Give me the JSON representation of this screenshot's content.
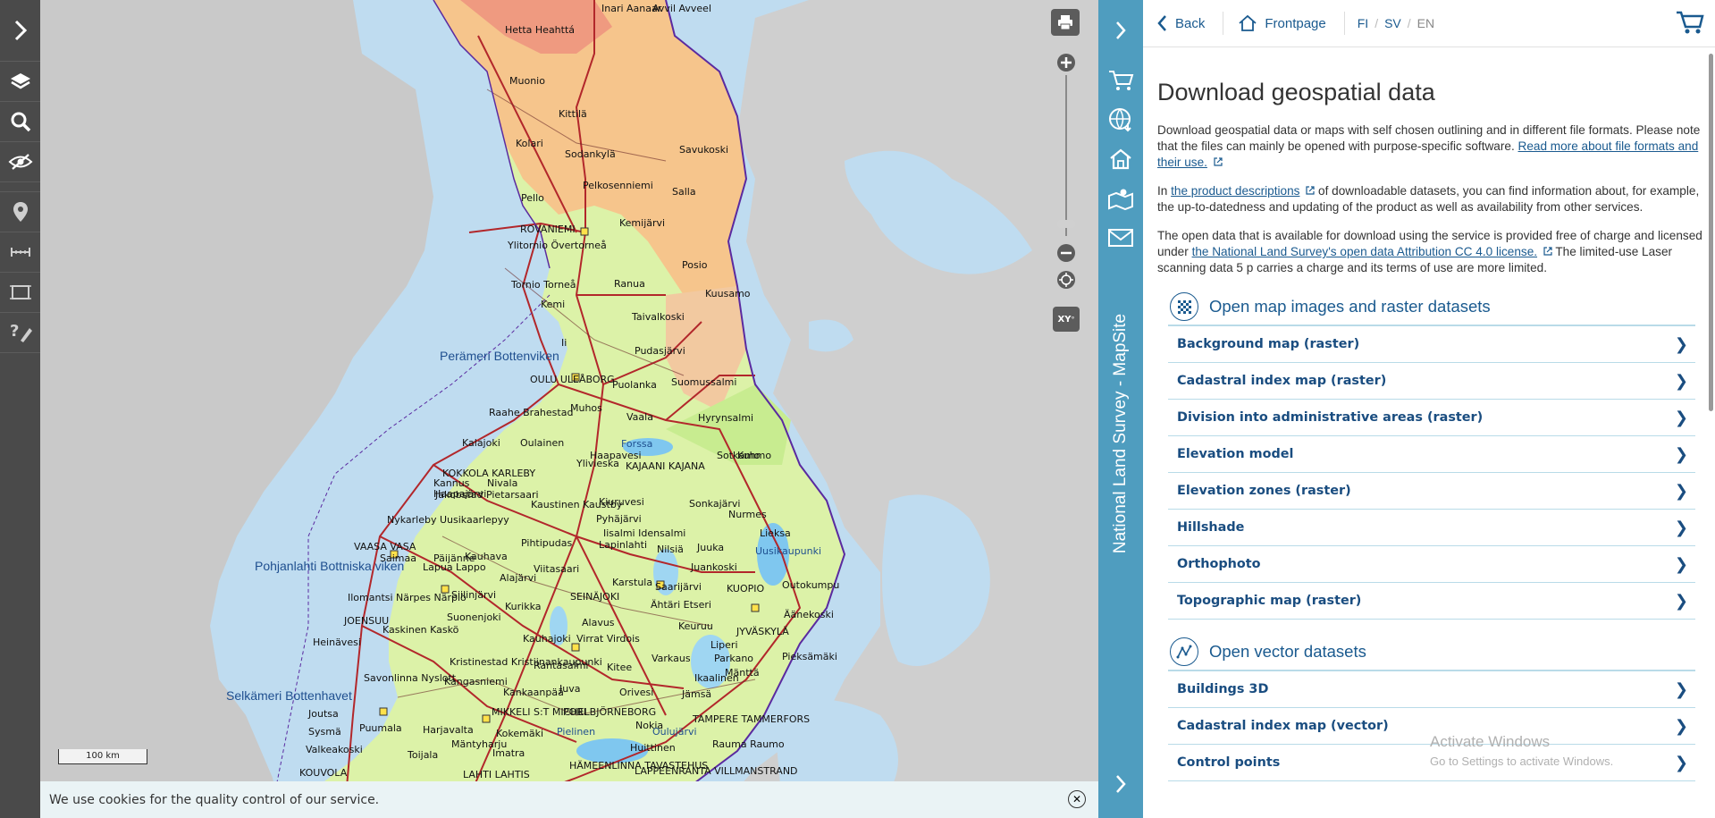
{
  "panel": {
    "back": "Back",
    "frontpage": "Frontpage",
    "lang_fi": "FI",
    "lang_sv": "SV",
    "lang_en": "EN",
    "sep": "/",
    "title": "Download geospatial data",
    "p1_text": "Download geospatial data or maps with self chosen outlining and in different file formats. Please note that the files can mainly be opened with purpose-specific software.",
    "p1_link": "Read more about file formats and their use.",
    "p2_pre": "In",
    "p2_link": "the product descriptions",
    "p2_post": "of downloadable datasets, you can find information about, for example, the up-to-datedness and updating of the product as well as availability from other services.",
    "p3_pre": "The open data that is available for download using the service is provided free of charge and licensed under",
    "p3_link": "the National Land Survey's open data Attribution CC 4.0 license.",
    "p3_post": "The limited-use Laser scanning data 5 p carries a charge and its terms of use are more limited.",
    "sections": [
      {
        "title": "Open map images and raster datasets",
        "items": [
          "Background map (raster)",
          "Cadastral index map (raster)",
          "Division into administrative areas (raster)",
          "Elevation model",
          "Elevation zones (raster)",
          "Hillshade",
          "Orthophoto",
          "Topographic map (raster)"
        ]
      },
      {
        "title": "Open vector datasets",
        "items": [
          "Buildings 3D",
          "Cadastral index map (vector)",
          "Control points"
        ]
      }
    ]
  },
  "rail": {
    "title": "National Land Survey - MapSite"
  },
  "map": {
    "scale": "100 km",
    "xy_label": "XY",
    "sea_labels": [
      "Perämeri Bottenviken",
      "Pohjanlahti Bottniska viken",
      "Selkämeri Bottenhavet"
    ],
    "places": [
      "Hetta Heahttá",
      "Inari Aanaar",
      "Avvil Avveel",
      "Muonio",
      "Kittilä",
      "Kolari",
      "Sodankylä",
      "Savukoski",
      "Pelkosenniemi",
      "Pello",
      "Salla",
      "Kemijärvi",
      "ROVANIEMI",
      "Ylitornio Övertorneå",
      "Posio",
      "Tornio Torneå",
      "Kemi",
      "Ranua",
      "Kuusamo",
      "Taivalkoski",
      "Ii",
      "Pudasjärvi",
      "OULU ULEÅBORG",
      "Puolanka",
      "Suomussalmi",
      "Raahe Brahestad",
      "Muhos",
      "Vaala",
      "Hyrynsalmi",
      "Kalajoki",
      "Oulainen",
      "Haapavesi",
      "Sotkamo",
      "Kuhmo",
      "KOKKOLA KARLEBY",
      "Ylivieska",
      "KAJAANI KAJANA",
      "Kannus",
      "Nivala",
      "Jakobstad Pietarsaari",
      "Haapajärvi",
      "Kaustinen Kaustby",
      "Kiuruvesi",
      "Sonkajärvi",
      "Nurmes",
      "Nykarleby Uusikaarlepyy",
      "Pyhäjärvi",
      "Iisalmi Idensalmi",
      "Lieksa",
      "VAASA VASA",
      "Lapinlahti",
      "Nilsiä",
      "Juuka",
      "Pihtipudas",
      "Kauhava",
      "Lapua Lappo",
      "Viitasaari",
      "Juankoski",
      "Alajärvi",
      "Karstula",
      "Siilinjärvi",
      "SEINÄJOKI",
      "Saarijärvi",
      "KUOPIO",
      "Outokumpu",
      "Ilomantsi",
      "Närpes Närpiö",
      "Kurikka",
      "Ähtäri Etseri",
      "Suonenjoki",
      "Alavus",
      "Äänekoski",
      "JOENSUU",
      "Kaskinen Kaskö",
      "Kauhajoki",
      "Virrat Virdois",
      "Keuruu",
      "JYVÄSKYLÄ",
      "Heinävesi",
      "Liperi",
      "Kristinestad Kristiinankaupunki",
      "Varkaus",
      "Parkano",
      "Pieksämäki",
      "Rantasalmi",
      "Kitee",
      "Mänttä",
      "Kangasniemi",
      "Savonlinna Nyslott",
      "Ikaalinen",
      "Kankaanpää",
      "Juva",
      "Orivesi",
      "Jämsä",
      "Joutsa",
      "MIKKELI S:T MICHEL",
      "PORI BJÖRNEBORG",
      "TAMPERE TAMMERFORS",
      "Sysmä",
      "Puumala",
      "Harjavalta",
      "Kokemäki",
      "Nokia",
      "Valkeakoski",
      "Mäntyharju",
      "Rauma Raumo",
      "Toijala",
      "Imatra",
      "Huittinen",
      "HÄMEENLINNA TAVASTEHUS",
      "LAPPEENRANTA VILLMANSTRAND",
      "LAHTI LAHTIS",
      "KOUVOLA",
      "Forssa",
      "Uusikaupunki",
      "Oulujärvi",
      "Pielinen",
      "Saimaa",
      "Päijänne"
    ]
  },
  "cookie": {
    "text": "We use cookies for the quality control of our service."
  },
  "watermark": {
    "line1": "Activate Windows",
    "line2": "Go to Settings to activate Windows."
  }
}
